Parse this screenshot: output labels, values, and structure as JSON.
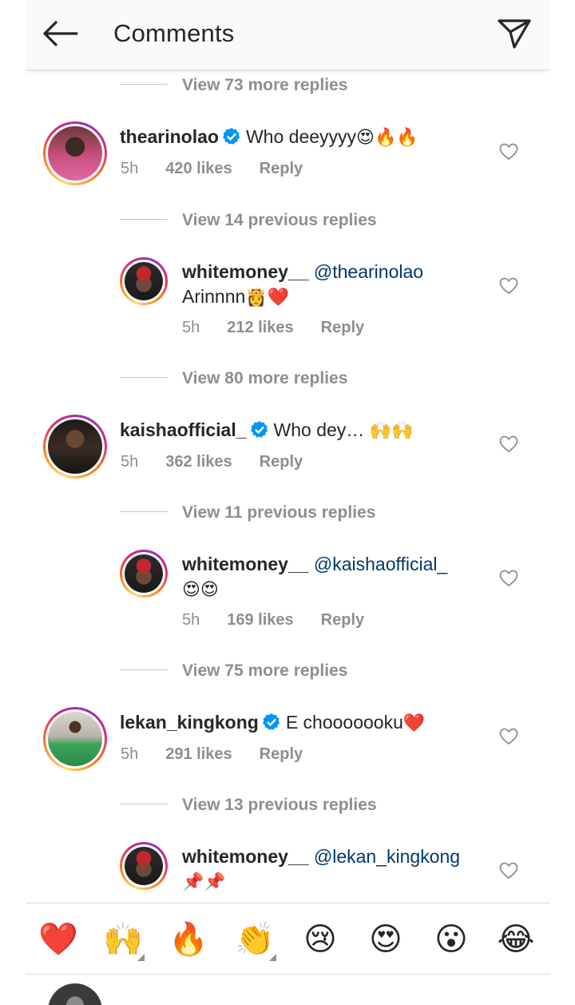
{
  "header": {
    "title": "Comments"
  },
  "comments": [
    {
      "view_more": "View 73 more replies"
    },
    {
      "username": "thearinolao",
      "text": "Who deeyyyy",
      "emoji": "😍🔥🔥",
      "time": "5h",
      "likes": "420 likes",
      "reply": "Reply",
      "replies_toggle": "View 14 previous replies",
      "reply_item": {
        "username": "whitemoney__",
        "mention": "@thearinolao",
        "text": "Arinnnn",
        "emoji": "👸❤️",
        "time": "5h",
        "likes": "212 likes",
        "reply": "Reply"
      },
      "more_replies": "View 80 more replies"
    },
    {
      "username": "kaishaofficial_",
      "text": "Who dey… ",
      "emoji": "🙌🙌",
      "time": "5h",
      "likes": "362 likes",
      "reply": "Reply",
      "replies_toggle": "View 11 previous replies",
      "reply_item": {
        "username": "whitemoney__",
        "mention": "@kaishaofficial_",
        "text": "",
        "emoji": "😍😍",
        "time": "5h",
        "likes": "169 likes",
        "reply": "Reply"
      },
      "more_replies": "View 75 more replies"
    },
    {
      "username": "lekan_kingkong",
      "text": "E chooooooku",
      "emoji": "❤️",
      "time": "5h",
      "likes": "291 likes",
      "reply": "Reply",
      "replies_toggle": "View 13 previous replies",
      "reply_item": {
        "username": "whitemoney__",
        "mention": "@lekan_kingkong",
        "text": "",
        "emoji": "📌📌"
      }
    }
  ],
  "emoji_bar": [
    {
      "glyph": "❤️",
      "icon": "red-heart-icon"
    },
    {
      "glyph": "🙌",
      "icon": "raising-hands-icon",
      "has_variants": true
    },
    {
      "glyph": "🔥",
      "icon": "fire-icon"
    },
    {
      "glyph": "👏",
      "icon": "clapping-hands-icon",
      "has_variants": true
    },
    {
      "glyph": "😢",
      "icon": "crying-face-icon"
    },
    {
      "glyph": "😍",
      "icon": "heart-eyes-icon"
    },
    {
      "glyph": "😮",
      "icon": "surprised-face-icon"
    },
    {
      "glyph": "😂",
      "icon": "tears-of-joy-icon"
    }
  ],
  "colors": {
    "text": "#262626",
    "muted": "#8e8e8e",
    "mention": "#00376b",
    "verified": "#0095f6",
    "heart": "#ed4956"
  }
}
